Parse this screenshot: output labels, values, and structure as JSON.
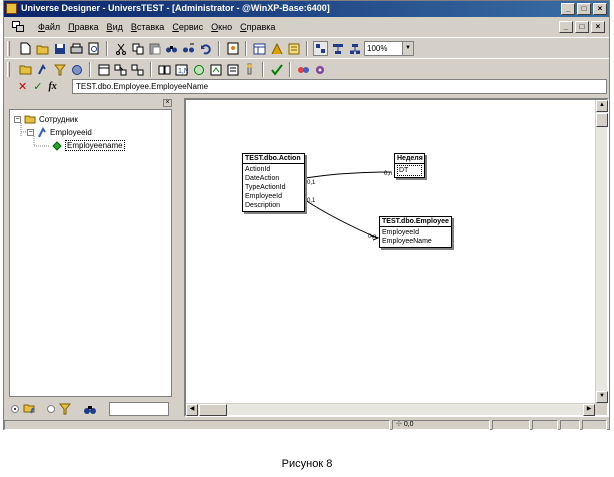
{
  "window": {
    "title": "Universe Designer - UniversTEST - [Administrator - @WinXP-Base:6400]",
    "controls": [
      "_",
      "□",
      "×"
    ]
  },
  "menu": {
    "items": [
      {
        "ul": "Ф",
        "rest": "айл"
      },
      {
        "ul": "П",
        "rest": "равка"
      },
      {
        "ul": "В",
        "rest": "ид"
      },
      {
        "ul": "В",
        "rest": "ставка"
      },
      {
        "ul": "С",
        "rest": "ервис"
      },
      {
        "ul": "О",
        "rest": "кно"
      },
      {
        "ul": "С",
        "rest": "правка"
      }
    ],
    "mdi_controls": [
      "_",
      "□",
      "×"
    ]
  },
  "toolbar": {
    "zoom": "100%",
    "icons_row1": [
      "new-icon",
      "open-icon",
      "save-icon",
      "print-icon",
      "print-preview-icon",
      "cut-icon",
      "copy-icon",
      "paste-icon",
      "find-icon",
      "find-next-icon",
      "undo-icon",
      "view-icon",
      "table-browser-icon",
      "joins-icon",
      "contexts-icon",
      "arrange-icon",
      "zoom-in-icon",
      "zoom-out-icon"
    ],
    "icons_row2": [
      "class-icon",
      "object-icon",
      "condition-icon",
      "hierarchy-icon",
      "insert-table-icon",
      "join-icon",
      "detect-joins-icon",
      "detect-cardinality-icon",
      "detect-contexts-icon",
      "check-integrity-icon",
      "refresh-icon",
      "parameters-icon",
      "security-icon",
      "link-icon"
    ]
  },
  "formula": {
    "value": "TEST.dbo.Employee.EmployeeName"
  },
  "tree": {
    "root": "Сотрудник",
    "child": "Employeeid",
    "grandchild": "Employeename"
  },
  "diagram": {
    "tables": [
      {
        "name": "TEST.dbo.Action",
        "columns": [
          "ActionId",
          "DateAction",
          "TypeActionId",
          "EmployeeId",
          "Description"
        ]
      },
      {
        "name": "Неделя",
        "columns": [
          "DT"
        ]
      },
      {
        "name": "TEST.dbo.Employee",
        "columns": [
          "EmployeeId",
          "EmployeeName"
        ]
      }
    ],
    "cardinalities": {
      "action_week_left": "0,1",
      "action_week_right": "0,n",
      "action_employee_left": "0,1",
      "action_employee_right": "0,n"
    }
  },
  "status": {
    "coords": "0,0"
  },
  "caption": "Рисунок 8"
}
